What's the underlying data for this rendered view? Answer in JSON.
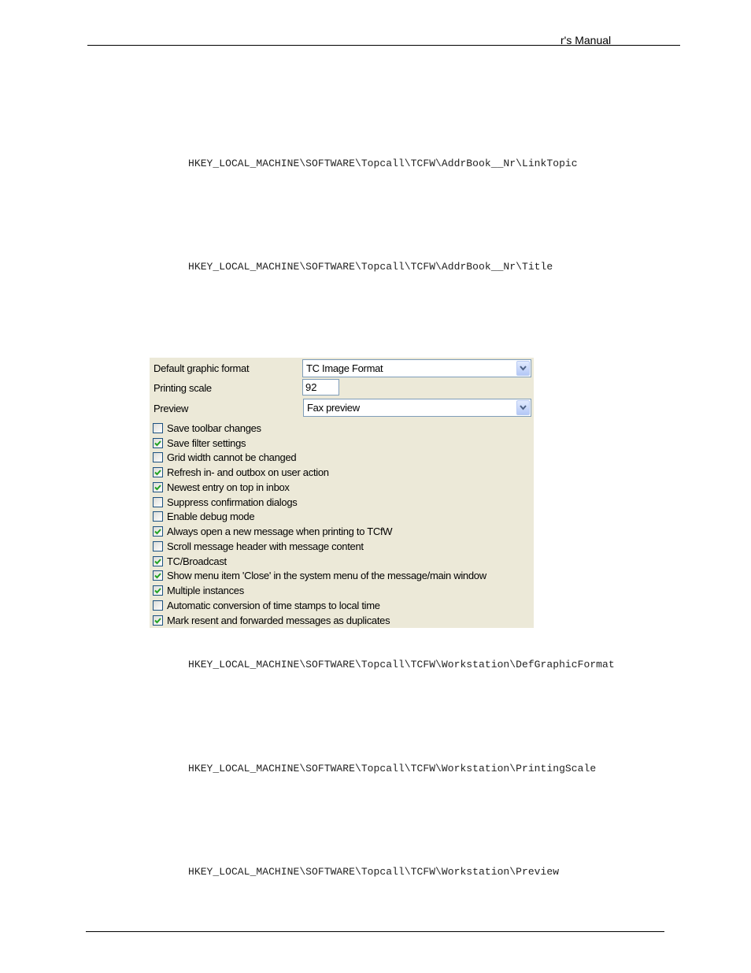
{
  "header": {
    "title": "r's Manual"
  },
  "registry_paths": [
    "HKEY_LOCAL_MACHINE\\SOFTWARE\\Topcall\\TCFW\\AddrBook__Nr\\LinkTopic",
    "HKEY_LOCAL_MACHINE\\SOFTWARE\\Topcall\\TCFW\\AddrBook__Nr\\Title",
    "HKEY_LOCAL_MACHINE\\SOFTWARE\\Topcall\\TCFW\\Workstation\\DefGraphicFormat",
    "HKEY_LOCAL_MACHINE\\SOFTWARE\\Topcall\\TCFW\\Workstation\\PrintingScale",
    "HKEY_LOCAL_MACHINE\\SOFTWARE\\Topcall\\TCFW\\Workstation\\Preview"
  ],
  "settings_panel": {
    "default_graphic_format": {
      "label": "Default graphic format",
      "value": "TC Image Format",
      "icon": "chevron-down-icon"
    },
    "printing_scale": {
      "label": "Printing scale",
      "value": "92"
    },
    "preview": {
      "label": "Preview",
      "value": "Fax preview",
      "icon": "chevron-down-icon"
    },
    "checkboxes": [
      {
        "label": "Save toolbar changes",
        "checked": false
      },
      {
        "label": "Save filter settings",
        "checked": true
      },
      {
        "label": "Grid width cannot be changed",
        "checked": false
      },
      {
        "label": "Refresh in- and outbox on user action",
        "checked": true
      },
      {
        "label": "Newest entry on top in inbox",
        "checked": true
      },
      {
        "label": "Suppress confirmation dialogs",
        "checked": false
      },
      {
        "label": "Enable debug mode",
        "checked": false
      },
      {
        "label": "Always open a new message when printing to TCfW",
        "checked": true
      },
      {
        "label": "Scroll message header with message content",
        "checked": false
      },
      {
        "label": "TC/Broadcast",
        "checked": true
      },
      {
        "label": "Show menu item 'Close' in the system menu of the message/main window",
        "checked": true
      },
      {
        "label": "Multiple instances",
        "checked": true
      },
      {
        "label": "Automatic conversion of time stamps to local time",
        "checked": false
      },
      {
        "label": "Mark resent and forwarded messages as duplicates",
        "checked": true
      }
    ]
  },
  "colors": {
    "panel_bg": "#ECE9D8",
    "check_mark": "#21A121",
    "field_border": "#7F9DB9"
  }
}
